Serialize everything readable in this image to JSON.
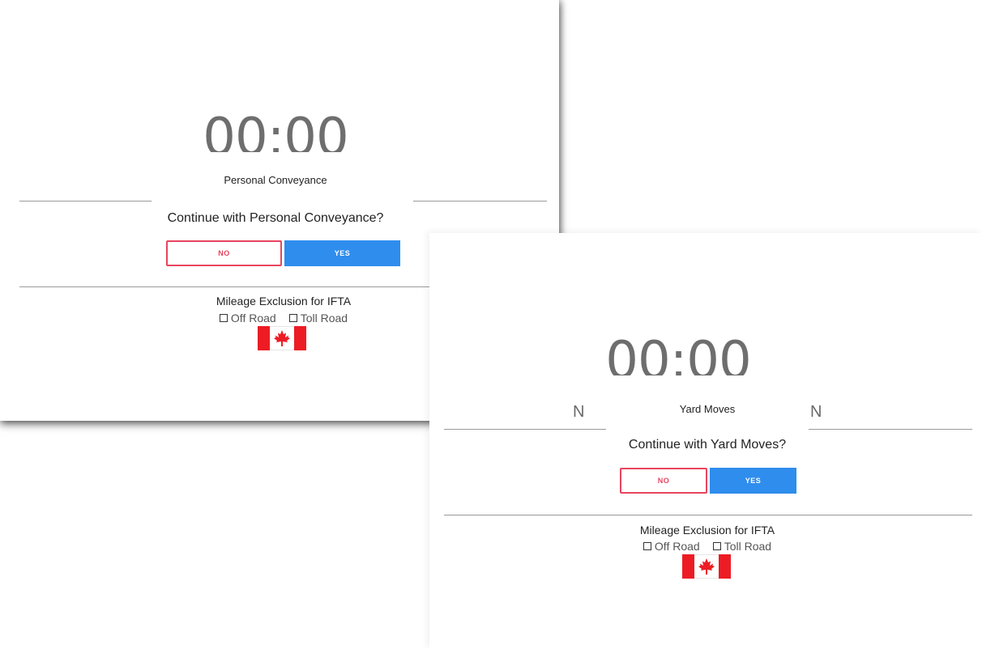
{
  "personal_conveyance_screen": {
    "timer": "00:00",
    "mode_title": "Personal Conveyance",
    "question": "Continue with Personal Conveyance?",
    "no_label": "NO",
    "yes_label": "YES",
    "ifta_label": "Mileage Exclusion for IFTA",
    "off_road_label": "Off Road",
    "toll_road_label": "Toll Road",
    "flag_icon": "canada-flag-icon"
  },
  "yard_moves_screen": {
    "timer": "00:00",
    "left_letter": "N",
    "right_letter": "N",
    "mode_title": "Yard Moves",
    "question": "Continue with Yard Moves?",
    "no_label": "NO",
    "yes_label": "YES",
    "ifta_label": "Mileage Exclusion for IFTA",
    "off_road_label": "Off Road",
    "toll_road_label": "Toll Road",
    "flag_icon": "canada-flag-icon"
  },
  "colors": {
    "no_border": "#e8455f",
    "yes_fill": "#2f8ded",
    "timer_text": "#6e6e6e",
    "flag_red": "#ed1c24"
  }
}
